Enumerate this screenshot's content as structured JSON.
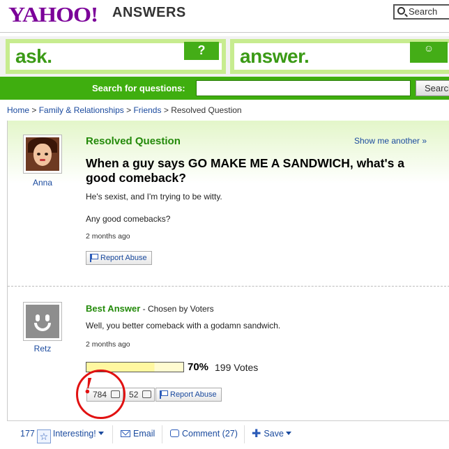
{
  "brand": {
    "logo": "YAHOO!",
    "product": "ANSWERS"
  },
  "header": {
    "search_button": "Search"
  },
  "nav": {
    "ask_label": "ask.",
    "ask_badge": "?",
    "answer_label": "answer.",
    "answer_badge": "☺"
  },
  "search_bar": {
    "label": "Search for questions:",
    "input_value": "",
    "button": "Search"
  },
  "breadcrumbs": [
    "Home",
    "Family & Relationships",
    "Friends",
    "Resolved Question"
  ],
  "breadcrumb_sep": ">",
  "question": {
    "status": "Resolved Question",
    "show_me_another": "Show me another »",
    "asker": "Anna",
    "title": "When a guy says GO MAKE ME A SANDWICH, what's a good comeback?",
    "body_1": "He's sexist, and I'm trying to be witty.",
    "body_2": "Any good comebacks?",
    "time": "2 months ago",
    "report": "Report Abuse"
  },
  "answer": {
    "heading": "Best Answer",
    "chosen_by": " - Chosen by Voters",
    "author": "Retz",
    "text": "Well, you better comeback with a godamn sandwich.",
    "time": "2 months ago",
    "vote_percent_value": 70,
    "vote_percent": "70%",
    "votes": "199 Votes",
    "thumbs_up": "784",
    "thumbs_down": "52",
    "report": "Report Abuse",
    "annotation": "!"
  },
  "footer": {
    "interesting_count": "177",
    "interesting_label": "Interesting!",
    "email": "Email",
    "comment": "Comment (27)",
    "save": "Save"
  },
  "colors": {
    "brand_purple": "#7b0099",
    "green": "#3fae0f",
    "link": "#1a4a9e",
    "highlight_red": "#e11111"
  }
}
